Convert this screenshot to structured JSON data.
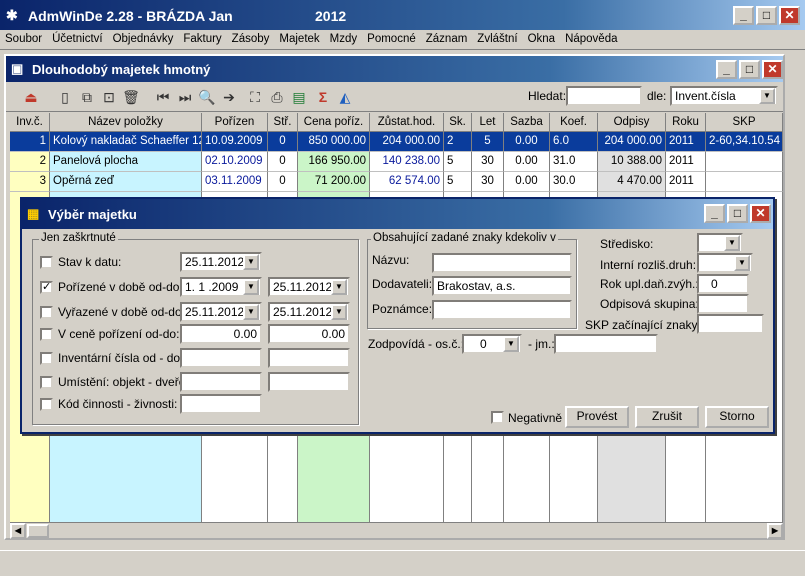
{
  "app": {
    "title": "AdmWinDe 2.28 - BRÁZDA Jan",
    "year": "2012",
    "menu": [
      "Soubor",
      "Účetnictví",
      "Objednávky",
      "Faktury",
      "Zásoby",
      "Majetek",
      "Mzdy",
      "Pomocné",
      "Záznam",
      "Zvláštní",
      "Okna",
      "Nápověda"
    ]
  },
  "child": {
    "title": "Dlouhodobý majetek hmotný",
    "search_label": "Hledat:",
    "search_value": "",
    "by_label": "dle:",
    "by_value": "Invent.čísla"
  },
  "grid": {
    "headers": [
      "Inv.č.",
      "Název položky",
      "Pořízen",
      "Stř.",
      "Cena poříz.",
      "Zůstat.hod.",
      "Sk.",
      "Let",
      "Sazba",
      "Koef.",
      "Odpisy",
      "Roku",
      "SKP"
    ],
    "rows": [
      [
        "1",
        "Kolový nakladač Schaeffer 12",
        "10.09.2009",
        "0",
        "850 000.00",
        "204 000.00",
        "2",
        "5",
        "0.00",
        "6.0",
        "204 000.00",
        "2011",
        "2-60,34.10.54"
      ],
      [
        "2",
        "Panelová plocha",
        "02.10.2009",
        "0",
        "166 950.00",
        "140 238.00",
        "5",
        "30",
        "0.00",
        "31.0",
        "10 388.00",
        "2011",
        ""
      ],
      [
        "3",
        "Opěrná zeď",
        "03.11.2009",
        "0",
        "71 200.00",
        "62 574.00",
        "5",
        "30",
        "0.00",
        "30.0",
        "4 470.00",
        "2011",
        ""
      ]
    ]
  },
  "dialog": {
    "title": "Výběr majetku",
    "group_checked": "Jen zaškrtnuté",
    "stav_label": "Stav k datu:",
    "stav_value": "25.11.2012",
    "porizene_label": "Pořízené v době od-do:",
    "porizene_from": "1. 1 .2009",
    "porizene_to": "25.11.2012",
    "vyrazene_label": "Vyřazené v době od-do:",
    "vyrazene_from": "25.11.2012",
    "vyrazene_to": "25.11.2012",
    "cena_label": "V ceně pořízení od-do:",
    "cena_from": "0.00",
    "cena_to": "0.00",
    "inv_label": "Inventární čísla od - do:",
    "umisteni_label": "Umístění: objekt - dveře:",
    "kod_label": "Kód činnosti - živnosti:",
    "group_contains": "Obsahující zadané znaky kdekoliv v",
    "nazvu_label": "Názvu:",
    "nazvu_value": "",
    "dodavatel_label": "Dodavateli:",
    "dodavatel_value": "Brakostav, a.s.",
    "poznamce_label": "Poznámce:",
    "poznamce_value": "",
    "zodpovida_label": "Zodpovídá - os.č.:",
    "zodpovida_value": "0",
    "jm_label": "- jm.:",
    "jm_value": "",
    "stredisko_label": "Středisko:",
    "interni_label": "Interní rozliš.druh:",
    "rok_label": "Rok upl.daň.zvýh.:",
    "rok_value": "0",
    "odpisova_label": "Odpisová skupina:",
    "skp_label": "SKP začínající znaky:",
    "negativne_label": "Negativně",
    "btn_provest": "Provést",
    "btn_zrusit": "Zrušit",
    "btn_storno": "Storno"
  }
}
